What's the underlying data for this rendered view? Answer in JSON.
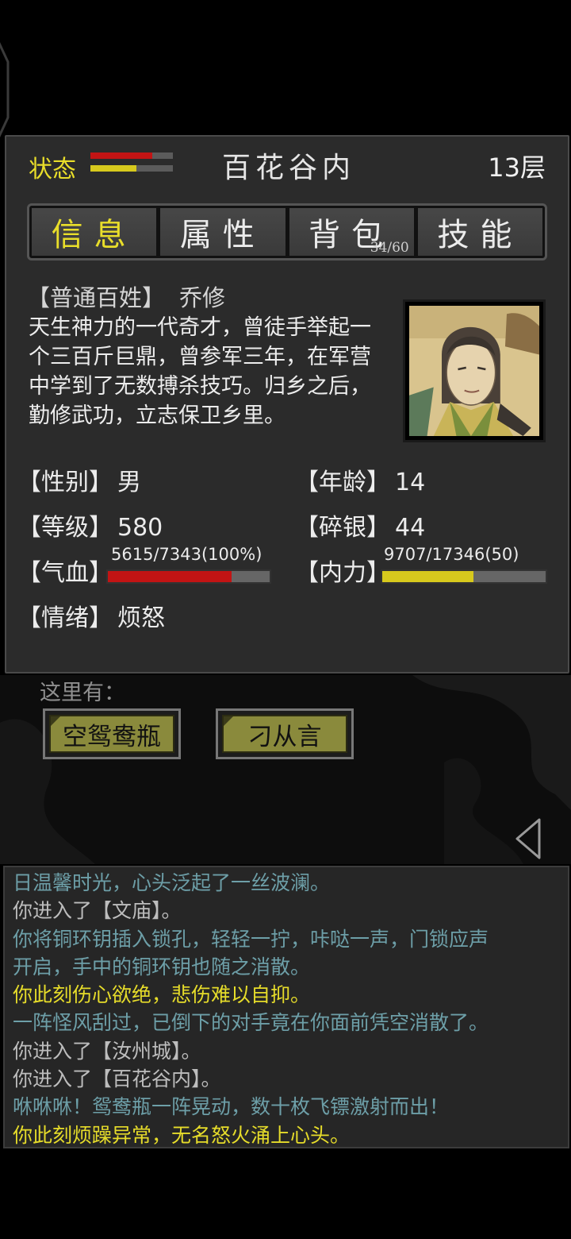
{
  "header": {
    "status_label": "状态",
    "hp_ratio": 0.75,
    "mp_ratio": 0.56,
    "location": "百花谷内",
    "floor": "13层"
  },
  "tabs": [
    {
      "label": "信息",
      "active": true
    },
    {
      "label": "属性",
      "active": false
    },
    {
      "label": "背包",
      "active": false,
      "count": "34/60"
    },
    {
      "label": "技能",
      "active": false
    }
  ],
  "character": {
    "title": "【普通百姓】",
    "name": "乔修",
    "desc_lines": [
      "天生神力的一代奇才，曾徒手举起一",
      "个三百斤巨鼎，曾参军三年，在军营",
      "中学到了无数搏杀技巧。归乡之后，",
      "勤修武功，立志保卫乡里。"
    ],
    "portrait_icon": "character-portrait"
  },
  "stats": {
    "gender": {
      "label": "【性别】",
      "value": "男"
    },
    "age": {
      "label": "【年龄】",
      "value": "14"
    },
    "level": {
      "label": "【等级】",
      "value": "580"
    },
    "silver": {
      "label": "【碎银】",
      "value": "44"
    },
    "hp": {
      "label": "【气血】",
      "value": "5615/7343(100%)",
      "ratio": 0.765
    },
    "mp": {
      "label": "【内力】",
      "value": "9707/17346(50)",
      "ratio": 0.56
    },
    "mood": {
      "label": "【情绪】",
      "value": "烦怒"
    }
  },
  "scene": {
    "label": "这里有：",
    "items": [
      "空鸳鸯瓶",
      "刁从言"
    ],
    "back_icon": "triangle-left-icon"
  },
  "log": [
    {
      "text": "日温馨时光，心头泛起了一丝波澜。",
      "color": "#6d9fa8"
    },
    {
      "text": "你进入了【文庙】。",
      "color": "#bdbdbd"
    },
    {
      "text": "你将铜环钥插入锁孔，轻轻一拧，咔哒一声，门锁应声",
      "color": "#6d9fa8"
    },
    {
      "text": "开启，手中的铜环钥也随之消散。",
      "color": "#6d9fa8"
    },
    {
      "text": "你此刻伤心欲绝，悲伤难以自抑。",
      "color": "#e6dc2a"
    },
    {
      "text": "一阵怪风刮过，已倒下的对手竟在你面前凭空消散了。",
      "color": "#6d9fa8"
    },
    {
      "text": "你进入了【汝州城】。",
      "color": "#bdbdbd"
    },
    {
      "text": "你进入了【百花谷内】。",
      "color": "#bdbdbd"
    },
    {
      "text": "咻咻咻！鸳鸯瓶一阵晃动，数十枚飞镖激射而出！",
      "color": "#6d9fa8"
    },
    {
      "text": "你此刻烦躁异常，无名怒火涌上心头。",
      "color": "#e6dc2a"
    }
  ],
  "colors": {
    "accent_yellow": "#e9de2a",
    "hp_red": "#c21414",
    "panel_bg": "#2b2b2b"
  }
}
